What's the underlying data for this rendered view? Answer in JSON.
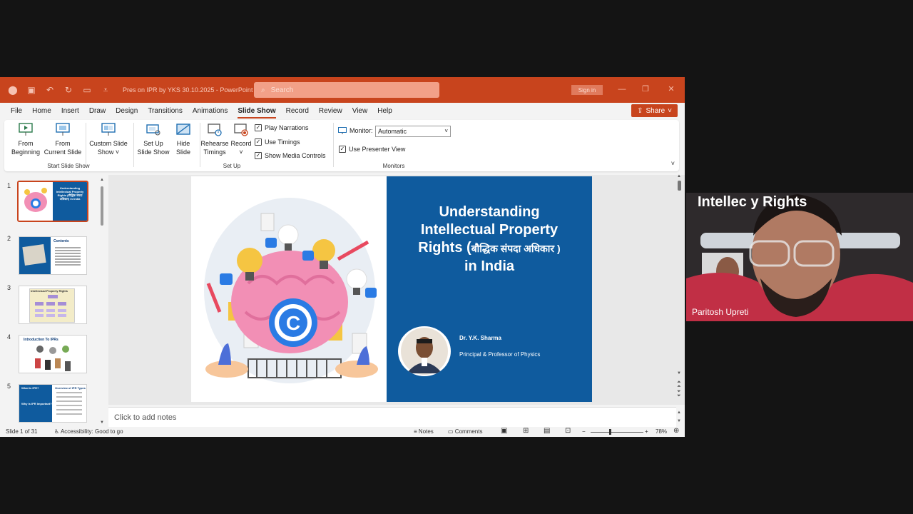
{
  "app": {
    "doc_title": "Pres on IPR by YKS 30.10.2025  -  PowerPoint",
    "search_placeholder": "Search",
    "sign_in": "Sign in",
    "share": "Share"
  },
  "menu": [
    "File",
    "Home",
    "Insert",
    "Draw",
    "Design",
    "Transitions",
    "Animations",
    "Slide Show",
    "Record",
    "Review",
    "View",
    "Help"
  ],
  "active_tab": "Slide Show",
  "ribbon": {
    "from_beginning": [
      "From",
      "Beginning"
    ],
    "from_current": [
      "From",
      "Current Slide"
    ],
    "custom_show": [
      "Custom Slide",
      "Show ˅"
    ],
    "set_up": [
      "Set Up",
      "Slide Show"
    ],
    "hide_slide": [
      "Hide",
      "Slide"
    ],
    "rehearse": [
      "Rehearse",
      "Timings"
    ],
    "record": [
      "Record",
      "˅"
    ],
    "play_narrations": "Play Narrations",
    "use_timings": "Use Timings",
    "show_media_controls": "Show Media Controls",
    "monitor_label": "Monitor:",
    "monitor_value": "Automatic",
    "use_presenter_view": "Use Presenter View",
    "group_start": "Start Slide Show",
    "group_setup": "Set Up",
    "group_monitors": "Monitors"
  },
  "thumbnails": {
    "numbers": [
      "1",
      "2",
      "3",
      "4",
      "5"
    ],
    "t1_title": "Understanding Intellectual Property Rights (बौद्धिक संपदा अधिकार) in India",
    "t2_title": "Contents",
    "t3_title": "Intellectual Property Rights",
    "t4_title": "Introduction To IPRs",
    "t5_left": "What is IPR?",
    "t5_right": "Overview of IPR Types",
    "t5_left2": "Why is IPR Important?"
  },
  "slide": {
    "title_l1": "Understanding",
    "title_l2": "Intellectual Property",
    "title_l3a": "Rights (",
    "title_l3b": "बौद्धिक संपदा अधिकार",
    "title_l3c": " )",
    "title_l4": "in India",
    "author": "Dr. Y.K. Sharma",
    "role": "Principal & Professor of Physics"
  },
  "notes_placeholder": "Click to add notes",
  "status": {
    "slide_pos": "Slide 1 of 31",
    "accessibility": "Accessibility: Good to go",
    "notes": "Notes",
    "comments": "Comments",
    "zoom": "78%"
  },
  "video": {
    "banner": "Intellec        y Rights",
    "participant": "Paritosh Upreti"
  },
  "colors": {
    "ppt_accent": "#c8441d",
    "slide_blue": "#0f5b9e"
  }
}
